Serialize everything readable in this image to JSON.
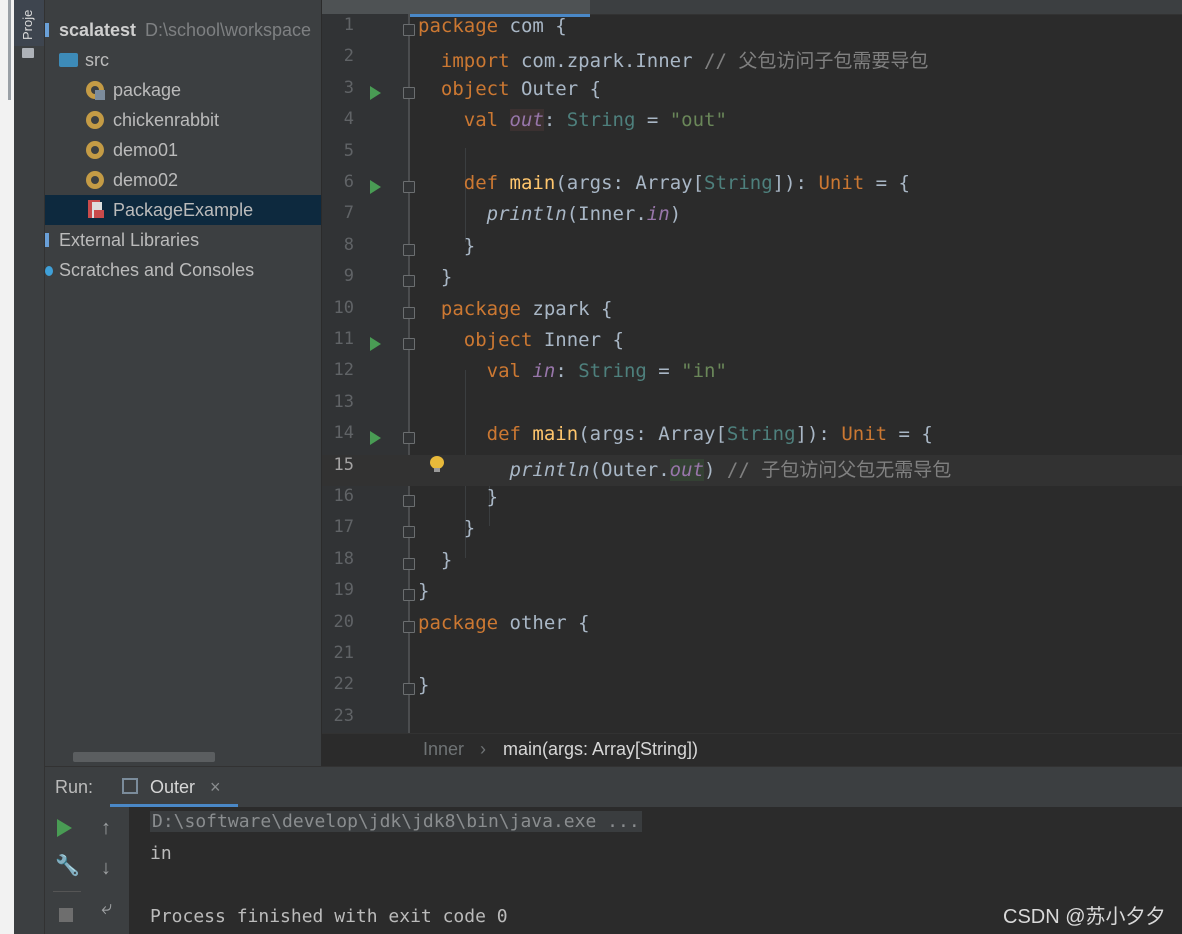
{
  "sidebar": {
    "tab_label": "Proje",
    "tree": [
      {
        "label": "scalatest",
        "suffix": "D:\\school\\workspace",
        "kind": "project"
      },
      {
        "label": "src",
        "kind": "folder"
      },
      {
        "label": "package",
        "kind": "package"
      },
      {
        "label": "chickenrabbit",
        "kind": "package"
      },
      {
        "label": "demo01",
        "kind": "package"
      },
      {
        "label": "demo02",
        "kind": "package"
      },
      {
        "label": "PackageExample",
        "kind": "scala-file",
        "selected": true
      },
      {
        "label": "External Libraries",
        "kind": "library"
      },
      {
        "label": "Scratches and Consoles",
        "kind": "scratch"
      }
    ]
  },
  "editor": {
    "current_line": 15,
    "lines": [
      {
        "n": "1"
      },
      {
        "n": "2"
      },
      {
        "n": "3"
      },
      {
        "n": "4"
      },
      {
        "n": "5"
      },
      {
        "n": "6"
      },
      {
        "n": "7"
      },
      {
        "n": "8"
      },
      {
        "n": "9"
      },
      {
        "n": "10"
      },
      {
        "n": "11"
      },
      {
        "n": "12"
      },
      {
        "n": "13"
      },
      {
        "n": "14"
      },
      {
        "n": "15"
      },
      {
        "n": "16"
      },
      {
        "n": "17"
      },
      {
        "n": "18"
      },
      {
        "n": "19"
      },
      {
        "n": "20"
      },
      {
        "n": "21"
      },
      {
        "n": "22"
      },
      {
        "n": "23"
      }
    ],
    "tokens": {
      "l1_kw": "package",
      "l1_rest": " com {",
      "l2_kw": "import",
      "l2_rest": " com.zpark.Inner ",
      "l2_cmt": "// 父包访问子包需要导包",
      "l3_kw": "object",
      "l3_rest": " Outer {",
      "l4_kw": "val",
      "l4_id": "out",
      "l4_colon": ": ",
      "l4_type": "String",
      "l4_eq": " = ",
      "l4_str": "\"out\"",
      "l6_kw": "def",
      "l6_fn": "main",
      "l6_a": "(args: Array[",
      "l6_type": "String",
      "l6_b": "]): ",
      "l6_unit": "Unit",
      "l6_c": " = {",
      "l7_fn": "println",
      "l7_a": "(Inner.",
      "l7_fld": "in",
      "l7_b": ")",
      "l8": "}",
      "l9": "}",
      "l10_kw": "package",
      "l10_rest": " zpark {",
      "l11_kw": "object",
      "l11_rest": " Inner {",
      "l12_kw": "val",
      "l12_id": "in",
      "l12_colon": ": ",
      "l12_type": "String",
      "l12_eq": " = ",
      "l12_str": "\"in\"",
      "l14_kw": "def",
      "l14_fn": "main",
      "l14_a": "(args: Array[",
      "l14_type": "String",
      "l14_b": "]): ",
      "l14_unit": "Unit",
      "l14_c": " = {",
      "l15_fn": "println",
      "l15_a": "(Outer.",
      "l15_fld": "out",
      "l15_b": ") ",
      "l15_cmt": "// 子包访问父包无需导包",
      "l16": "}",
      "l17": "}",
      "l18": "}",
      "l19": "}",
      "l20_kw": "package",
      "l20_rest": " other {",
      "l22": "}"
    }
  },
  "breadcrumb": {
    "item1": "Inner",
    "separator": "›",
    "item2": "main(args: Array[String])"
  },
  "run_panel": {
    "label": "Run:",
    "tab": "Outer",
    "close": "×",
    "console": [
      "D:\\software\\develop\\jdk\\jdk8\\bin\\java.exe ...",
      "in",
      "",
      "Process finished with exit code 0"
    ]
  },
  "watermark": "CSDN @苏小夕夕"
}
